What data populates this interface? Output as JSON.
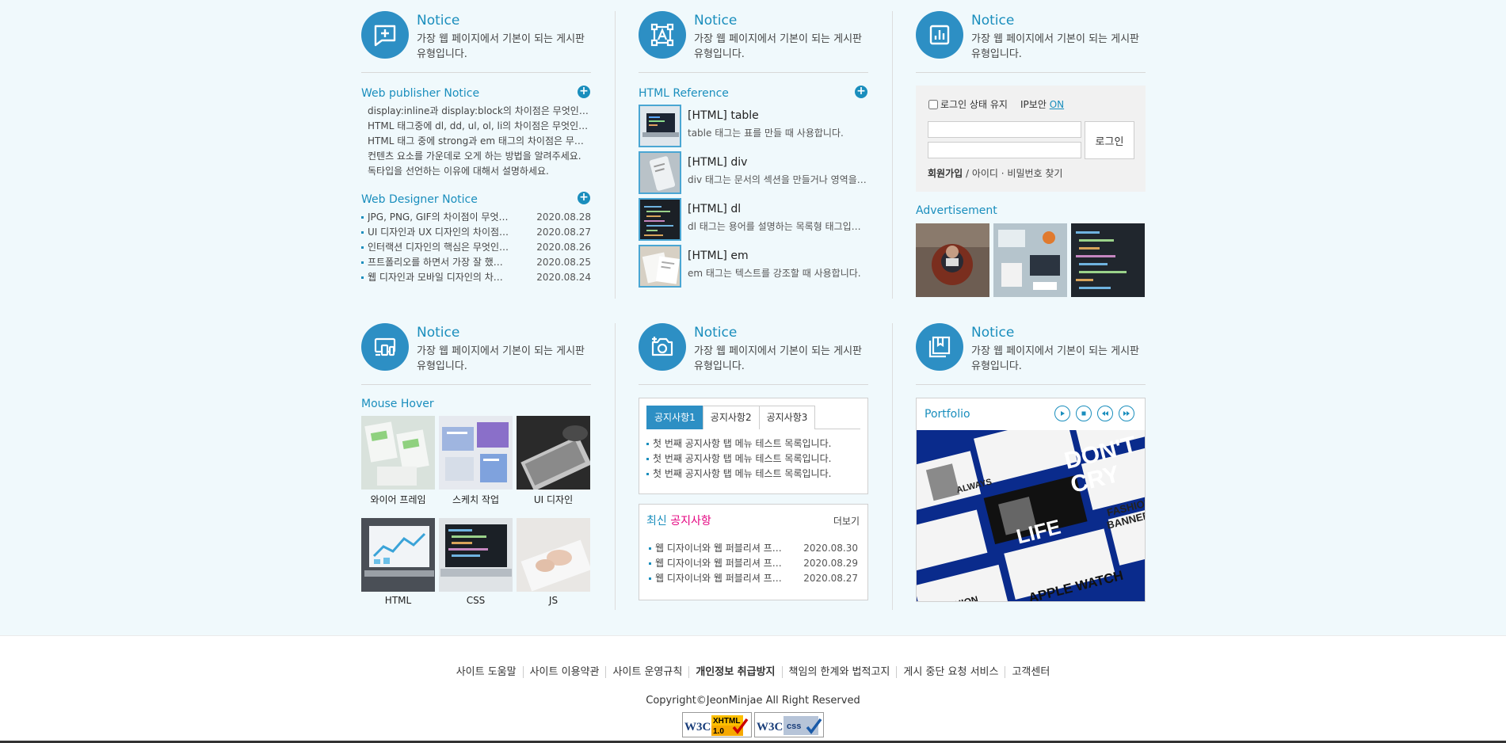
{
  "notice_title": "Notice",
  "notice_desc": "가장 웹 페이지에서 기본이 되는 게시판 유형입니다.",
  "publisher": {
    "title": "Web publisher Notice",
    "items": [
      "display:inline과 display:block의 차이점은 무엇인가요?",
      "HTML 태그중에 dl, dd, ul, ol, li의 차이점은 무엇인가요?",
      "HTML 태그 중에 strong과 em 태그의 차이점은 무엇인가요?",
      "컨텐츠 요소를 가운데로 오게 하는 방법을 알려주세요.",
      "독타입을 선언하는 이유에 대해서 설명하세요."
    ]
  },
  "designer": {
    "title": "Web Designer Notice",
    "items": [
      {
        "title": "JPG, PNG, GIF의 차이점이 무엇인가요?",
        "date": "2020.08.28"
      },
      {
        "title": "UI 디자인과 UX 디자인의 차이점은?",
        "date": "2020.08.27"
      },
      {
        "title": "인터랙션 디자인의 핵심은 무엇인가요?",
        "date": "2020.08.26"
      },
      {
        "title": "프트폴리오를 하면서 가장 잘 했던 점은?",
        "date": "2020.08.25"
      },
      {
        "title": "웹 디자인과 모바일 디자인의 차이점은?",
        "date": "2020.08.24"
      }
    ]
  },
  "reference": {
    "title": "HTML Reference",
    "items": [
      {
        "title": "[HTML] table",
        "desc": "table 태그는 표를 만들 때 사용합니다."
      },
      {
        "title": "[HTML] div",
        "desc": "div 태그는 문서의 섹션을 만들거나 영역을 나눌 때 사용합니다."
      },
      {
        "title": "[HTML] dl",
        "desc": "dl 태그는 용어를 설명하는 목록형 태그입니다."
      },
      {
        "title": "[HTML] em",
        "desc": "em 태그는 텍스트를 강조할 때 사용합니다."
      }
    ]
  },
  "login": {
    "keep_label": "로그인 상태 유지",
    "ip_label": "IP보안",
    "ip_status": "ON",
    "button": "로그인",
    "join": "회원가입",
    "find": " / 아이디 · 비밀번호 찾기"
  },
  "ad_title": "Advertisement",
  "hover": {
    "title": "Mouse Hover",
    "items": [
      "와이어 프레임",
      "스케치 작업",
      "UI 디자인",
      "HTML",
      "CSS",
      "JS"
    ]
  },
  "tabs": {
    "labels": [
      "공지사항1",
      "공지사항2",
      "공지사항3"
    ],
    "items": [
      "첫 번째 공지사항 탭 메뉴 테스트 목록입니다.",
      "첫 번째 공지사항 탭 메뉴 테스트 목록입니다.",
      "첫 번째 공지사항 탭 메뉴 테스트 목록입니다."
    ]
  },
  "latest": {
    "title_a": "최신 ",
    "title_b": "공지사항",
    "more": "더보기",
    "items": [
      {
        "title": "웹 디자이너와 웹 퍼블리셔 프로그래머",
        "date": "2020.08.30"
      },
      {
        "title": "웹 디자이너와 웹 퍼블리셔 프로그래머",
        "date": "2020.08.29"
      },
      {
        "title": "웹 디자이너와 웹 퍼블리셔 프로그래머",
        "date": "2020.08.27"
      }
    ]
  },
  "portfolio": {
    "title": "Portfolio",
    "texts": [
      "DON'T",
      "CRY",
      "ALWAYS",
      "FASHION",
      "BANNER",
      "LIFE",
      "APPLE WATCH",
      "FASHION"
    ]
  },
  "footer": {
    "links": [
      "사이트 도움말",
      "사이트 이용약관",
      "사이트 운영규칙",
      "개인정보 취급방지",
      "책임의 한계와 법적고지",
      "게시 중단 요청 서비스",
      "고객센터"
    ],
    "copyright": "Copyright©JeonMinjae All Right Reserved",
    "badge1": {
      "a": "W3C",
      "b": "XHTML",
      "c": "1.0"
    },
    "badge2": {
      "a": "W3C",
      "b": "css"
    }
  },
  "colors": {
    "accent": "#1a8ebd",
    "icon_bg": "#2d8fc4",
    "pink": "#e4007f",
    "background": "#f0f9fc"
  }
}
